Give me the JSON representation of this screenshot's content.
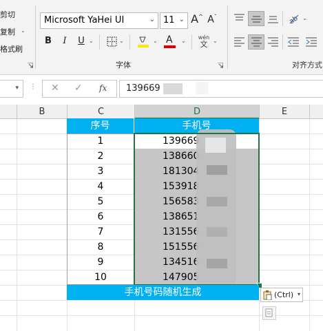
{
  "clipboard": {
    "cut": "剪切",
    "copy": "复制",
    "format_painter": "格式刷"
  },
  "font": {
    "name": "Microsoft YaHei UI",
    "size": "11",
    "group_label": "字体"
  },
  "alignment": {
    "group_label": "对齐方式"
  },
  "toolbar": {
    "bold": "B",
    "italic": "I",
    "underline": "U",
    "font_color_letter": "A",
    "phonetic": "wén",
    "grow_font": "A",
    "shrink_font": "A"
  },
  "formula_bar": {
    "function_label": "fx",
    "value": "139669"
  },
  "columns": [
    "B",
    "C",
    "D",
    "E"
  ],
  "table": {
    "header_index": "序号",
    "header_phone": "手机号",
    "rows": [
      {
        "index": "1",
        "phone": "139669"
      },
      {
        "index": "2",
        "phone": "138660"
      },
      {
        "index": "3",
        "phone": "181304"
      },
      {
        "index": "4",
        "phone": "153918"
      },
      {
        "index": "5",
        "phone": "156583"
      },
      {
        "index": "6",
        "phone": "138651"
      },
      {
        "index": "7",
        "phone": "131556"
      },
      {
        "index": "8",
        "phone": "151556"
      },
      {
        "index": "9",
        "phone": "134516"
      },
      {
        "index": "10",
        "phone": "147905"
      }
    ],
    "footer": "手机号码随机生成"
  },
  "paste_options": {
    "label": "(Ctrl)"
  },
  "colors": {
    "header_bg": "#00b0f0",
    "selection_bg": "#c6c6c6",
    "selection_border": "#217346",
    "font_color": "#e00000",
    "highlight": "#ffe600"
  }
}
